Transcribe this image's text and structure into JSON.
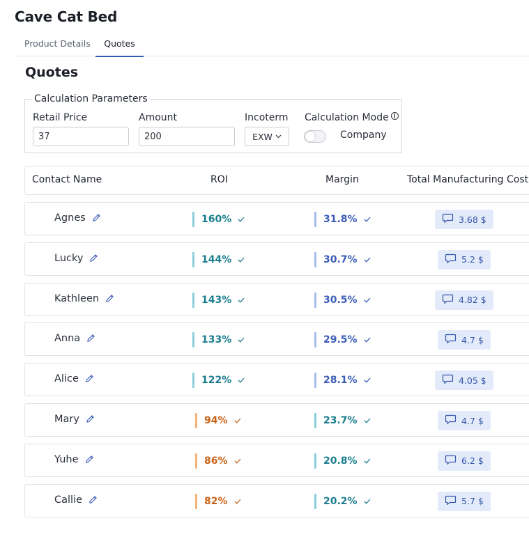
{
  "page": {
    "title": "Cave Cat Bed"
  },
  "tabs": [
    {
      "label": "Product Details",
      "active": false
    },
    {
      "label": "Quotes",
      "active": true
    }
  ],
  "section_title": "Quotes",
  "params": {
    "legend": "Calculation Parameters",
    "retail_price": {
      "label": "Retail Price",
      "value": "37"
    },
    "amount": {
      "label": "Amount",
      "value": "200"
    },
    "incoterm": {
      "label": "Incoterm",
      "value": "EXW"
    },
    "calc_mode": {
      "label": "Calculation Mode",
      "option": "Company",
      "on": false
    }
  },
  "table": {
    "headers": {
      "contact": "Contact Name",
      "roi": "ROI",
      "margin": "Margin",
      "cost": "Total Manufacturing Cost"
    },
    "rows": [
      {
        "name": "Agnes",
        "roi": "160%",
        "roi_color": "teal",
        "margin": "31.8%",
        "margin_color": "blue",
        "cost": "3.68 $"
      },
      {
        "name": "Lucky",
        "roi": "144%",
        "roi_color": "teal",
        "margin": "30.7%",
        "margin_color": "blue",
        "cost": "5.2 $"
      },
      {
        "name": "Kathleen",
        "roi": "143%",
        "roi_color": "teal",
        "margin": "30.5%",
        "margin_color": "blue",
        "cost": "4.82 $"
      },
      {
        "name": "Anna",
        "roi": "133%",
        "roi_color": "teal",
        "margin": "29.5%",
        "margin_color": "blue",
        "cost": "4.7 $"
      },
      {
        "name": "Alice",
        "roi": "122%",
        "roi_color": "teal",
        "margin": "28.1%",
        "margin_color": "blue",
        "cost": "4.05 $"
      },
      {
        "name": "Mary",
        "roi": "94%",
        "roi_color": "orange",
        "margin": "23.7%",
        "margin_color": "teal",
        "cost": "4.7 $"
      },
      {
        "name": "Yuhe",
        "roi": "86%",
        "roi_color": "orange",
        "margin": "20.8%",
        "margin_color": "teal",
        "cost": "6.2 $"
      },
      {
        "name": "Callie",
        "roi": "82%",
        "roi_color": "orange",
        "margin": "20.2%",
        "margin_color": "teal",
        "cost": "5.7 $"
      }
    ]
  },
  "icons": {
    "edit": "pencil-icon",
    "check": "check-icon",
    "cost": "chat-bubble-icon",
    "info": "info-icon",
    "dropdown": "chevron-down-icon"
  },
  "colors": {
    "teal": "#1b7e8f",
    "blue": "#3a5cb8",
    "orange": "#c96215",
    "accent": "#2f5fb3",
    "cost_bg": "#e3ebfb"
  }
}
